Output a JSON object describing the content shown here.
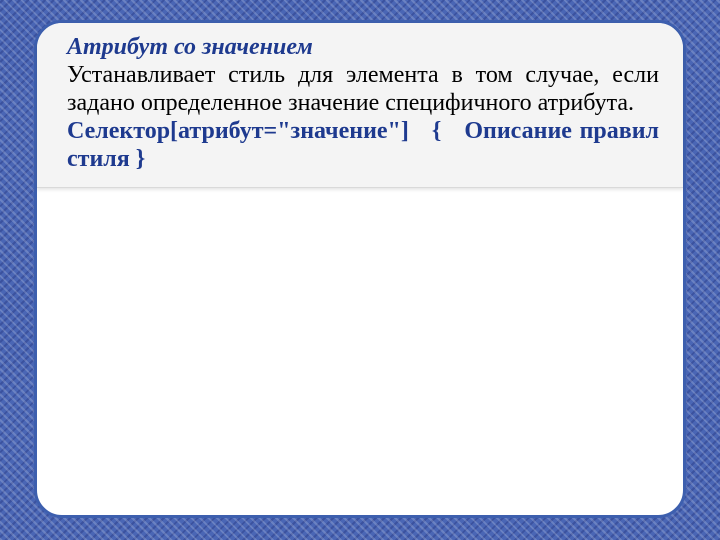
{
  "slide": {
    "heading": "Атрибут со значением",
    "body": "Устанавливает стиль для элемента в том случае, если задано определенное значение специфичного атрибута.",
    "selector": "Селектор[атрибут=\"значение\"]",
    "brace_open": "{",
    "rules_word1": "Описание",
    "rules_word2": "правил стиля",
    "brace_close": "}"
  }
}
